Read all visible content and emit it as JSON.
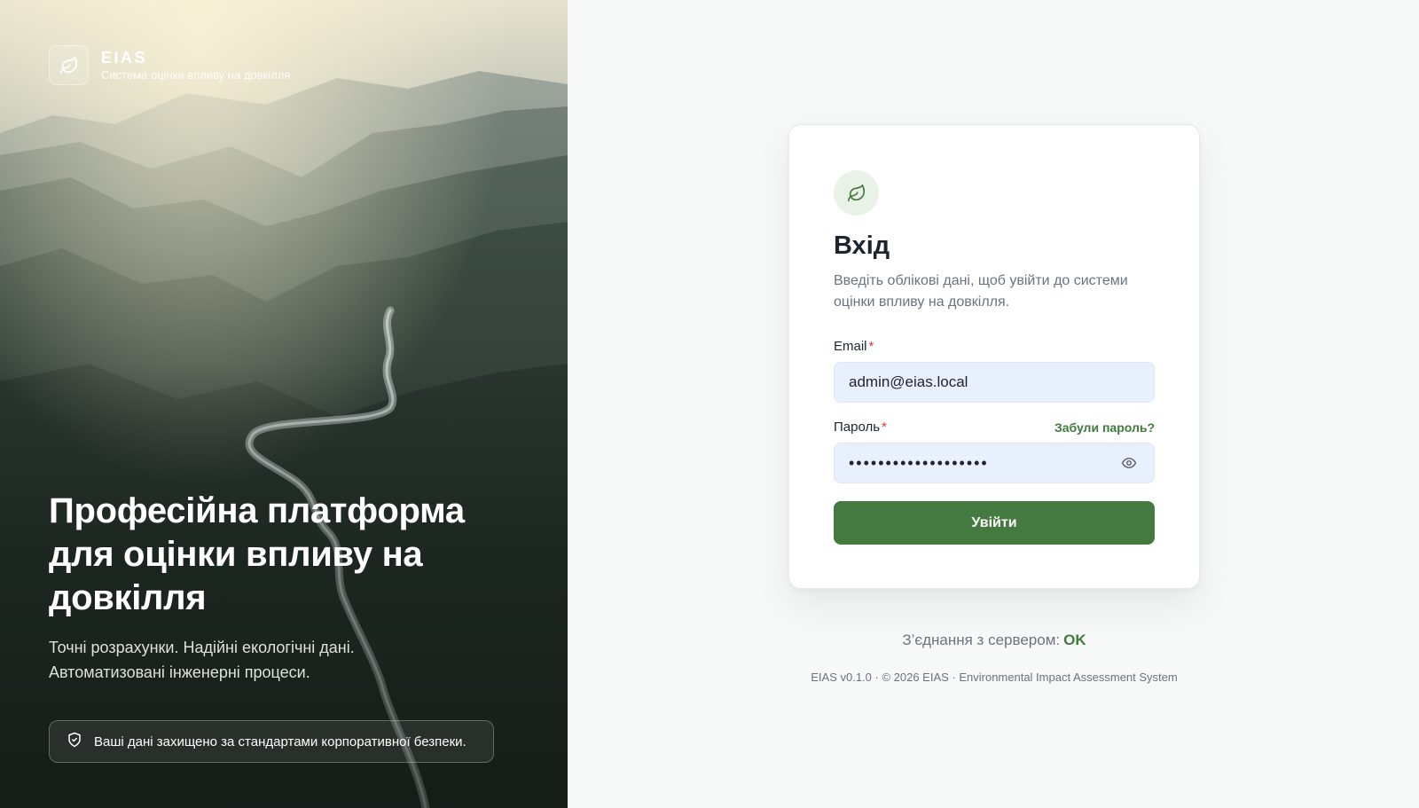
{
  "brand": {
    "name": "EIAS",
    "subtitle": "Система оцінки впливу на довкілля",
    "icon": "leaf-icon"
  },
  "hero": {
    "title": "Професійна платформа для оцінки впливу на довкілля",
    "subtitle": "Точні розрахунки. Надійні екологічні дані. Автоматизовані інженерні процеси.",
    "security_note": "Ваші дані захищено за стандартами корпоративної безпеки.",
    "security_icon": "shield-check-icon"
  },
  "login": {
    "icon": "leaf-icon",
    "title": "Вхід",
    "description": "Введіть облікові дані, щоб увійти до системи оцінки впливу на довкілля.",
    "email_label": "Email",
    "email_value": "admin@eias.local",
    "password_label": "Пароль",
    "password_value": "•••••••••••••••••••",
    "required_marker": "*",
    "forgot_password": "Забули пароль?",
    "show_password_icon": "eye-icon",
    "submit_label": "Увійти"
  },
  "status": {
    "connection_label": "З’єднання з сервером:",
    "connection_value": "OK"
  },
  "footer": {
    "text": "EIAS v0.1.0 · © 2026 EIAS · Environmental Impact Assessment System"
  },
  "colors": {
    "primary": "#447a3f",
    "link": "#3f7a3c",
    "required": "#d93b3b",
    "input_bg": "#e8f0fe",
    "page_bg": "#f7f8f8"
  }
}
